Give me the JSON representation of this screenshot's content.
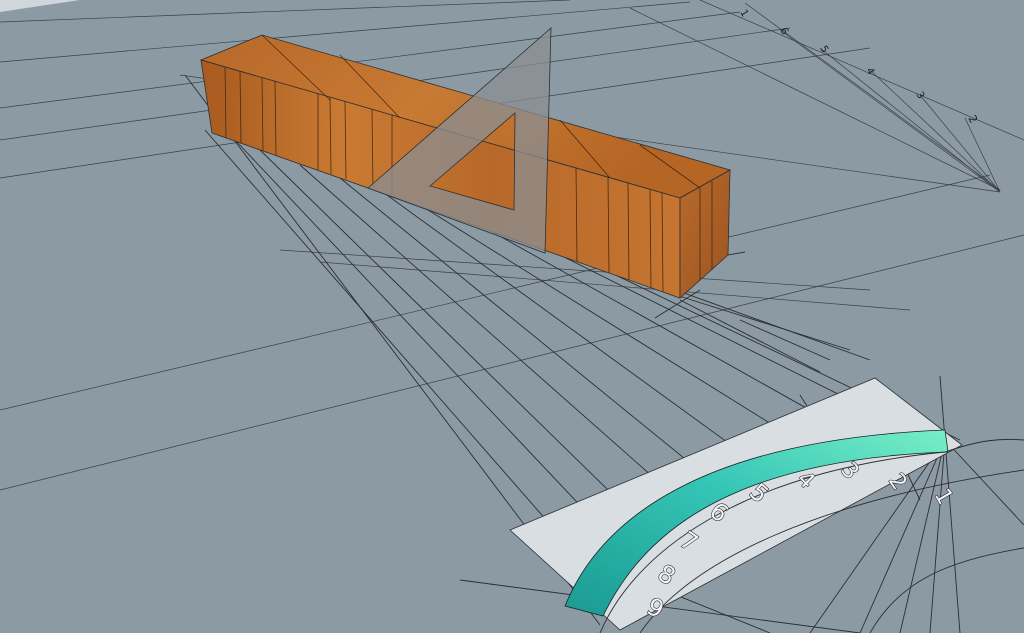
{
  "scene": {
    "background_color": "#8c9aa4",
    "wood_color_light": "#c9782e",
    "wood_color_dark": "#9a5520",
    "triangle_color": "#8a8f94",
    "band_color_dark": "#1f9c94",
    "band_color_light": "#6fe3c0",
    "label_panel_color": "#d9dee3"
  },
  "top_scale_labels": [
    "1",
    "6",
    "5",
    "4",
    "3",
    "2"
  ],
  "dial_labels": [
    "1",
    "2",
    "3",
    "4",
    "5",
    "6",
    "7",
    "8",
    "9"
  ]
}
